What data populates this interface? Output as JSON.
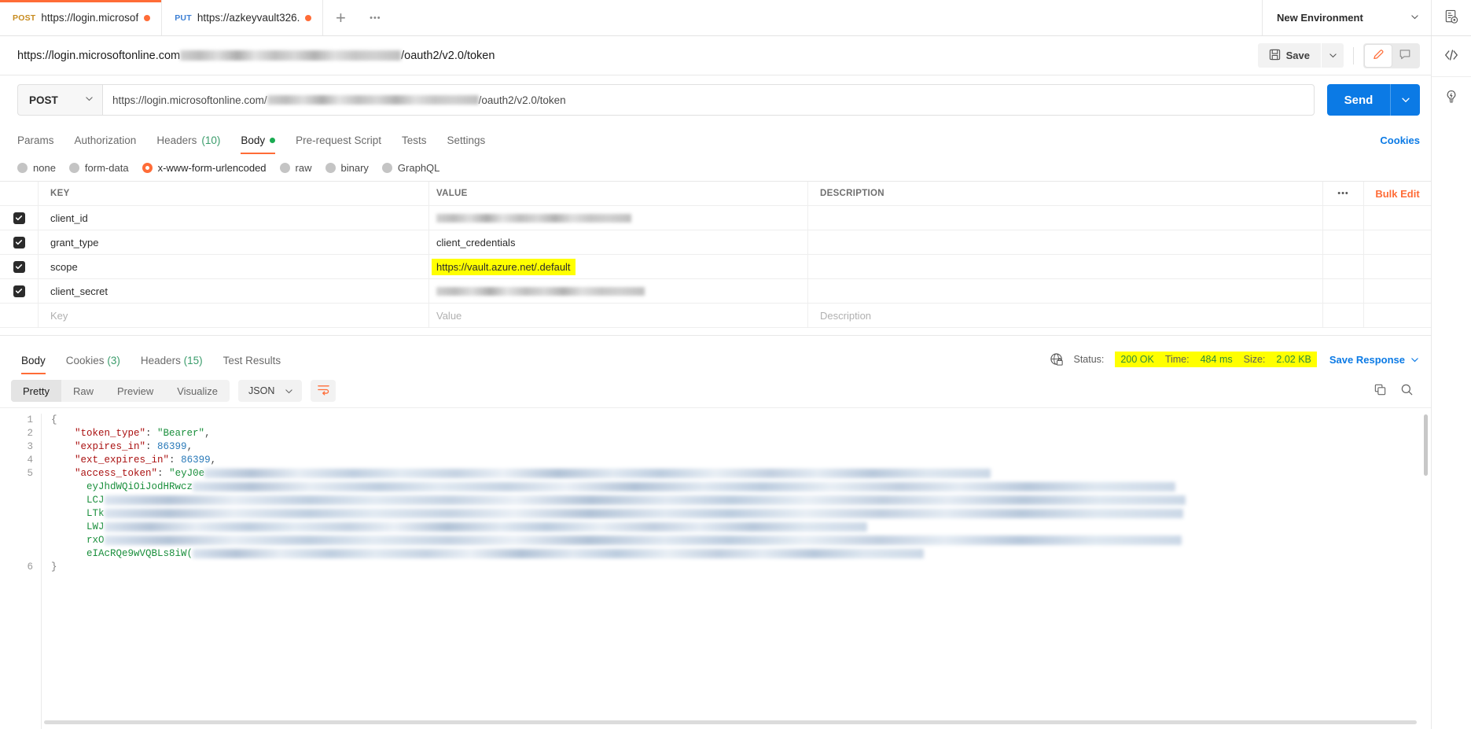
{
  "tabs": [
    {
      "method": "POST",
      "label": "https://login.microsof",
      "unsaved": true
    },
    {
      "method": "PUT",
      "label": "https://azkeyvault326.",
      "unsaved": true
    }
  ],
  "tabstrip": {
    "new_tab_label": "+",
    "more_label": "•••",
    "environment": "New Environment"
  },
  "request": {
    "title_prefix": "https://login.microsoftonline.com",
    "title_suffix": "/oauth2/v2.0/token",
    "method": "POST",
    "url_prefix": "https://login.microsoftonline.com/",
    "url_suffix": "/oauth2/v2.0/token",
    "save_label": "Save",
    "send_label": "Send"
  },
  "request_tabs": [
    {
      "label": "Params",
      "active": false,
      "dot": false,
      "count": ""
    },
    {
      "label": "Authorization",
      "active": false,
      "dot": false,
      "count": ""
    },
    {
      "label": "Headers",
      "active": false,
      "dot": false,
      "count": "(10)"
    },
    {
      "label": "Body",
      "active": true,
      "dot": true,
      "count": ""
    },
    {
      "label": "Pre-request Script",
      "active": false,
      "dot": false,
      "count": ""
    },
    {
      "label": "Tests",
      "active": false,
      "dot": false,
      "count": ""
    },
    {
      "label": "Settings",
      "active": false,
      "dot": false,
      "count": ""
    }
  ],
  "cookies_link": "Cookies",
  "body_types": [
    {
      "label": "none",
      "selected": false
    },
    {
      "label": "form-data",
      "selected": false
    },
    {
      "label": "x-www-form-urlencoded",
      "selected": true
    },
    {
      "label": "raw",
      "selected": false
    },
    {
      "label": "binary",
      "selected": false
    },
    {
      "label": "GraphQL",
      "selected": false
    }
  ],
  "kv_table": {
    "headers": {
      "key": "KEY",
      "value": "VALUE",
      "description": "DESCRIPTION"
    },
    "options_label": "•••",
    "bulk_edit_label": "Bulk Edit",
    "rows": [
      {
        "checked": true,
        "key": "client_id",
        "value": "",
        "value_redacted": true,
        "highlight": false,
        "description": ""
      },
      {
        "checked": true,
        "key": "grant_type",
        "value": "client_credentials",
        "value_redacted": false,
        "highlight": false,
        "description": ""
      },
      {
        "checked": true,
        "key": "scope",
        "value": "https://vault.azure.net/.default",
        "value_redacted": false,
        "highlight": true,
        "description": ""
      },
      {
        "checked": true,
        "key": "client_secret",
        "value": "",
        "value_redacted": true,
        "highlight": false,
        "description": ""
      }
    ],
    "placeholder_row": {
      "key": "Key",
      "value": "Value",
      "description": "Description"
    }
  },
  "response_tabs": [
    {
      "label": "Body",
      "active": true,
      "count": ""
    },
    {
      "label": "Cookies",
      "active": false,
      "count": "(3)"
    },
    {
      "label": "Headers",
      "active": false,
      "count": "(15)"
    },
    {
      "label": "Test Results",
      "active": false,
      "count": ""
    }
  ],
  "response_status": {
    "status_label": "Status:",
    "status_value": "200 OK",
    "time_label": "Time:",
    "time_value": "484 ms",
    "size_label": "Size:",
    "size_value": "2.02 KB",
    "save_response_label": "Save Response",
    "highlight_color": "#ffff00"
  },
  "response_toolbar": {
    "views": [
      {
        "label": "Pretty",
        "active": true
      },
      {
        "label": "Raw",
        "active": false
      },
      {
        "label": "Preview",
        "active": false
      },
      {
        "label": "Visualize",
        "active": false
      }
    ],
    "format": "JSON"
  },
  "response_body": {
    "language": "json",
    "line_numbers": [
      "1",
      "2",
      "3",
      "4",
      "5",
      "6"
    ],
    "lines": [
      {
        "n": "1",
        "open_brace": "{"
      },
      {
        "n": "2",
        "key": "\"token_type\"",
        "sep": ": ",
        "str": "\"Bearer\"",
        "tail": ","
      },
      {
        "n": "3",
        "key": "\"expires_in\"",
        "sep": ": ",
        "num": "86399",
        "tail": ","
      },
      {
        "n": "4",
        "key": "\"ext_expires_in\"",
        "sep": ": ",
        "num": "86399",
        "tail": ","
      },
      {
        "n": "5",
        "key": "\"access_token\"",
        "sep": ": ",
        "str": "\"eyJ0e",
        "redacted": true
      },
      {
        "n": "6",
        "close_brace": "}"
      }
    ],
    "token_fragments": [
      "eyJhdWQiOiJodHRwcz",
      "LCJ",
      "LTk",
      "LWJ",
      "rxO",
      "eIAcRQe9wVQBLs8iW("
    ]
  },
  "colors": {
    "accent": "#ff6c37",
    "send": "#0b7ae5",
    "status_ok": "#2b8a3e",
    "highlight": "#ffff00"
  }
}
